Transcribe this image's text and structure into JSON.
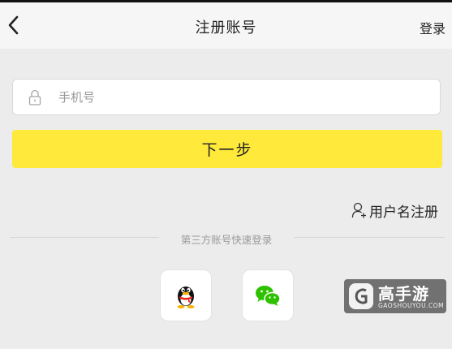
{
  "nav": {
    "title": "注册账号",
    "login_label": "登录",
    "back_icon": "chevron-left-icon"
  },
  "form": {
    "phone_placeholder": "手机号",
    "phone_value": "",
    "phone_icon": "lock-icon",
    "next_label": "下一步"
  },
  "username_register": {
    "label": "用户名注册",
    "icon": "user-add-icon"
  },
  "third_party": {
    "title": "第三方账号快速登录",
    "providers": [
      {
        "name": "qq",
        "icon": "qq-icon"
      },
      {
        "name": "wechat",
        "icon": "wechat-icon"
      }
    ]
  },
  "watermark": {
    "title": "高手游",
    "subtitle": "GAOSHOUYOU.COM"
  },
  "colors": {
    "accent_yellow": "#ffe93b",
    "background": "#ececec",
    "nav_background": "#f6f6f6",
    "wechat_green": "#2dc100"
  }
}
